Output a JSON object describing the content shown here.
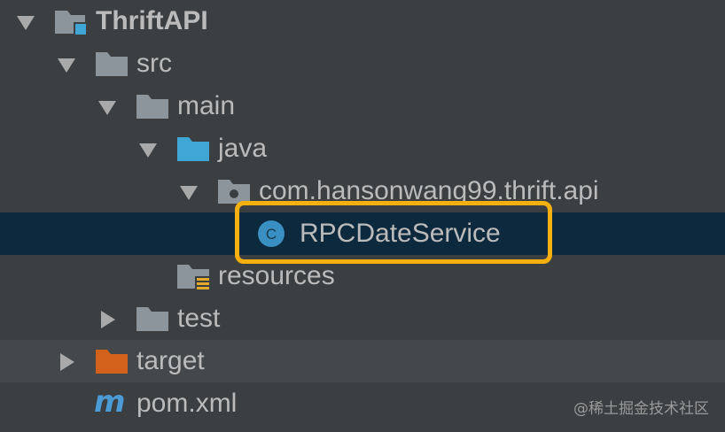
{
  "tree": {
    "root": {
      "label": "ThriftAPI",
      "expanded": true,
      "icon": "module-folder-icon"
    },
    "src": {
      "label": "src",
      "expanded": true,
      "icon": "folder-icon"
    },
    "main": {
      "label": "main",
      "expanded": true,
      "icon": "folder-icon"
    },
    "java": {
      "label": "java",
      "expanded": true,
      "icon": "source-root-folder-icon"
    },
    "package": {
      "label": "com.hansonwang99.thrift.api",
      "expanded": true,
      "icon": "package-folder-icon"
    },
    "class": {
      "label": "RPCDateService",
      "selected": true,
      "icon": "class-icon",
      "icon_letter": "C"
    },
    "resources": {
      "label": "resources",
      "icon": "resources-folder-icon"
    },
    "test": {
      "label": "test",
      "expanded": false,
      "icon": "folder-icon"
    },
    "target": {
      "label": "target",
      "expanded": false,
      "icon": "excluded-folder-icon"
    },
    "pom": {
      "label": "pom.xml",
      "icon": "maven-icon",
      "icon_letter": "m"
    }
  },
  "watermark": "@稀土掘金技术社区",
  "colors": {
    "background": "#3c3f41",
    "selection": "#0d293e",
    "highlight_border": "#f4b00e",
    "folder_gray": "#8c959c",
    "folder_blue": "#40a6d6",
    "folder_orange": "#d2611c",
    "class_icon": "#3a8fc2"
  }
}
